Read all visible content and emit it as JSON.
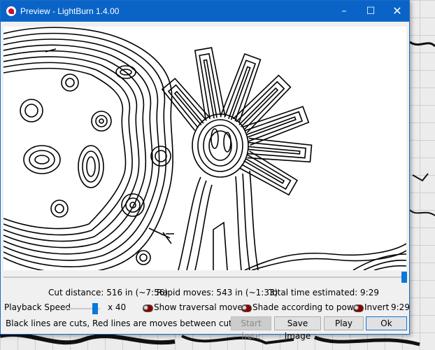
{
  "window": {
    "title": "Preview - LightBurn 1.4.00",
    "controls": {
      "minimize": "–",
      "maximize": "☐",
      "close": "✕"
    }
  },
  "stats": {
    "cut_distance": "Cut distance: 516 in (~7:56)",
    "rapid_moves": "Rapid moves: 543 in (~1:33)",
    "total_time": "Total time estimated: 9:29"
  },
  "playback": {
    "label": "Playback Speed",
    "multiplier": "x 40",
    "speed_level": 0.9
  },
  "toggles": {
    "show_traversal": "Show traversal moves",
    "shade_power": "Shade according to power",
    "invert": "Invert"
  },
  "time_value": "9:29",
  "legend": "Black lines are cuts, Red lines are moves between cuts",
  "buttons": {
    "start_here": "Start here",
    "save_image": "Save Image",
    "play": "Play",
    "ok": "Ok"
  },
  "colors": {
    "titlebar": "#0a64c8",
    "accent": "#0a78d7",
    "toggle_off": "#8b0000"
  }
}
